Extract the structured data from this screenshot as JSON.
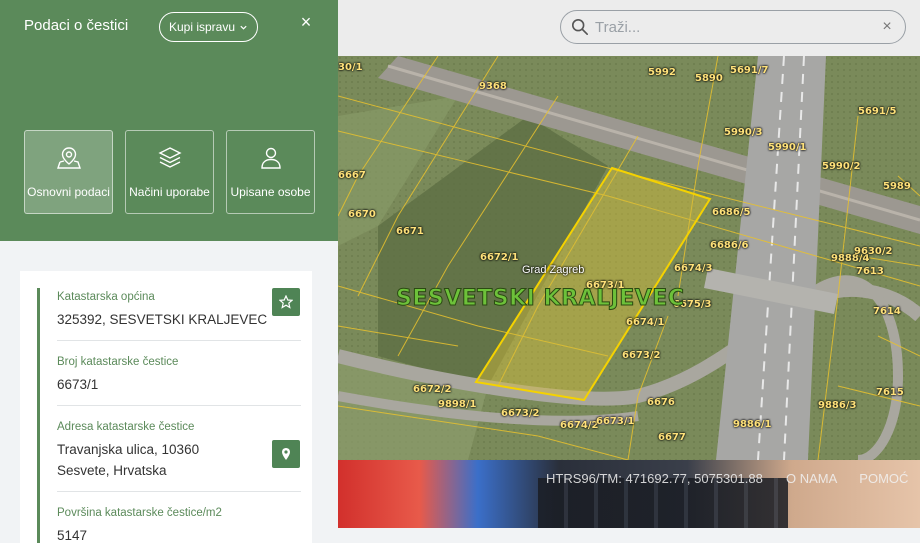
{
  "panel": {
    "title": "Podaci o čestici",
    "buy_label": "Kupi ispravu",
    "close_symbol": "×",
    "tabs": [
      {
        "label": "Osnovni podaci",
        "icon": "map-pin-icon",
        "active": true
      },
      {
        "label": "Načini uporabe",
        "icon": "layers-icon",
        "active": false
      },
      {
        "label": "Upisane osobe",
        "icon": "user-icon",
        "active": false
      }
    ],
    "fields": [
      {
        "label": "Katastarska općina",
        "value": "325392, SESVETSKI KRALJEVEC",
        "action": "star-icon"
      },
      {
        "label": "Broj katastarske čestice",
        "value": "6673/1"
      },
      {
        "label": "Adresa katastarske čestice",
        "value": "Travanjska ulica, 10360 Sesvete, Hrvatska",
        "action": "location-pin-icon"
      },
      {
        "label": "Površina katastarske čestice/m2",
        "value": "5147"
      }
    ]
  },
  "search": {
    "placeholder": "Traži...",
    "clear_symbol": "×"
  },
  "map": {
    "district_label": "SESVETSKI KRALJEVEC",
    "city_label": "Grad Zagreb",
    "parcel_labels": [
      "30/1",
      "9368",
      "5992",
      "5890",
      "5691/7",
      "5691/5",
      "5990/3",
      "5990/1",
      "5990/2",
      "5989",
      "6667",
      "6670",
      "6671",
      "6672/1",
      "6673/1",
      "6686/5",
      "6686/6",
      "6674/3",
      "6675/3",
      "6674/1",
      "9888/4",
      "7613",
      "9630/2",
      "7614",
      "6673/2",
      "6672/2",
      "9898/1",
      "6673/2",
      "6674/2",
      "6673/1",
      "6676",
      "6677",
      "9886/1",
      "9886/3",
      "7615"
    ]
  },
  "banner": {
    "coords": "HTRS96/TM: 471692.77, 5075301.88",
    "links": [
      "O NAMA",
      "POMOĆ"
    ]
  },
  "colors": {
    "panel_green": "#5b8a5a",
    "button_green": "#4f8455",
    "parcel_highlight": "#f5d200"
  }
}
